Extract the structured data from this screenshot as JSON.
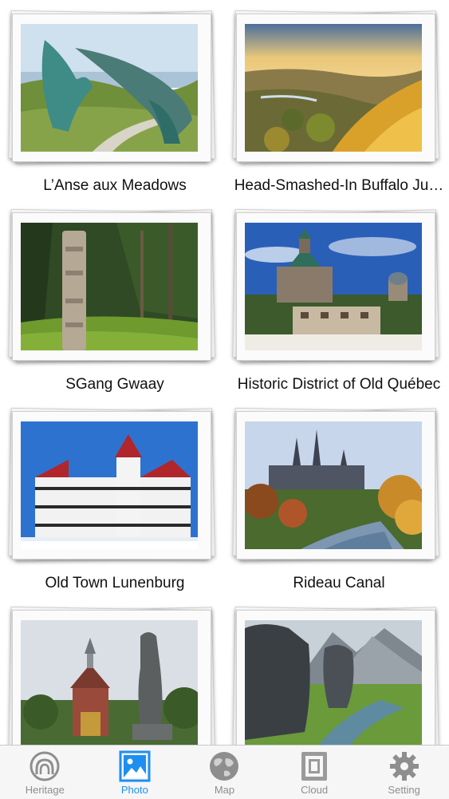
{
  "sites": [
    {
      "name": "L’Anse aux Meadows",
      "scene": "sculpture"
    },
    {
      "name": "Head-Smashed-In Buffalo Ju…",
      "scene": "prairie"
    },
    {
      "name": "SGang Gwaay",
      "scene": "totem"
    },
    {
      "name": "Historic District of Old Québec",
      "scene": "chateau"
    },
    {
      "name": "Old Town Lunenburg",
      "scene": "academy"
    },
    {
      "name": "Rideau Canal",
      "scene": "canal"
    },
    {
      "name": "",
      "scene": "church"
    },
    {
      "name": "",
      "scene": "rocks"
    }
  ],
  "tabbar": {
    "tabs": [
      {
        "label": "Heritage",
        "icon": "heritage-icon"
      },
      {
        "label": "Photo",
        "icon": "photo-icon"
      },
      {
        "label": "Map",
        "icon": "globe-icon"
      },
      {
        "label": "Cloud",
        "icon": "cloud-icon"
      },
      {
        "label": "Setting",
        "icon": "gear-icon"
      }
    ],
    "active_index": 1,
    "active_color": "#1e8ff0",
    "inactive_color": "#8e8e8e"
  }
}
